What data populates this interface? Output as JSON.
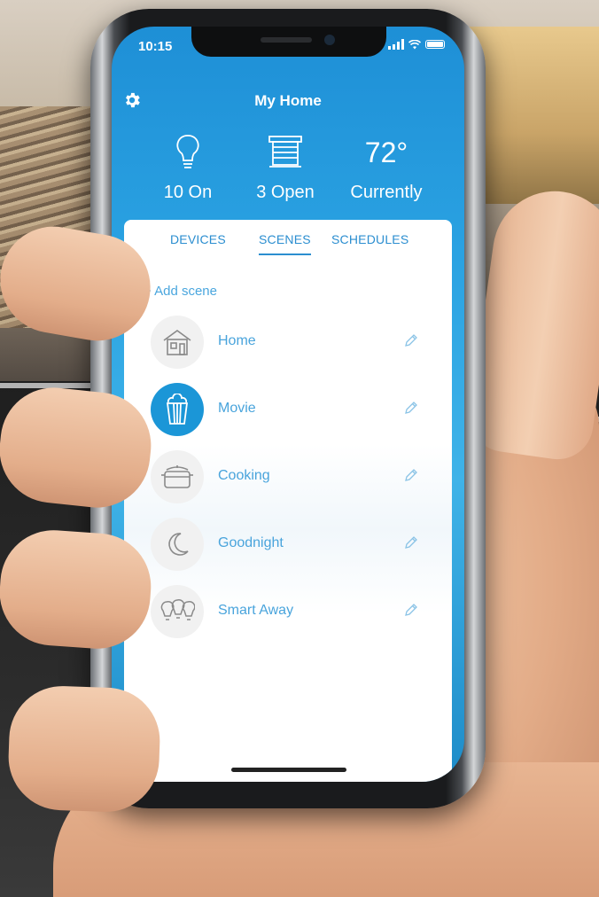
{
  "status_bar": {
    "time": "10:15"
  },
  "header": {
    "title": "My Home"
  },
  "stats": [
    {
      "icon": "lightbulb-icon",
      "label": "10 On"
    },
    {
      "icon": "window-blinds-icon",
      "label": "3 Open"
    },
    {
      "icon": "temperature-value",
      "value": "72°",
      "label": "Currently"
    }
  ],
  "tabs": [
    {
      "label": "DEVICES",
      "active": false
    },
    {
      "label": "SCENES",
      "active": true
    },
    {
      "label": "SCHEDULES",
      "active": false
    }
  ],
  "add_scene_label": "+ Add scene",
  "scenes": [
    {
      "name": "Home",
      "icon": "house-icon",
      "active": false
    },
    {
      "name": "Movie",
      "icon": "popcorn-icon",
      "active": true
    },
    {
      "name": "Cooking",
      "icon": "cooking-pot-icon",
      "active": false
    },
    {
      "name": "Goodnight",
      "icon": "moon-icon",
      "active": false
    },
    {
      "name": "Smart Away",
      "icon": "lightbulbs-icon",
      "active": false
    }
  ],
  "colors": {
    "accent": "#1b96d7",
    "header_blue": "#2aa2e2",
    "text_blue": "#49a4dc"
  }
}
